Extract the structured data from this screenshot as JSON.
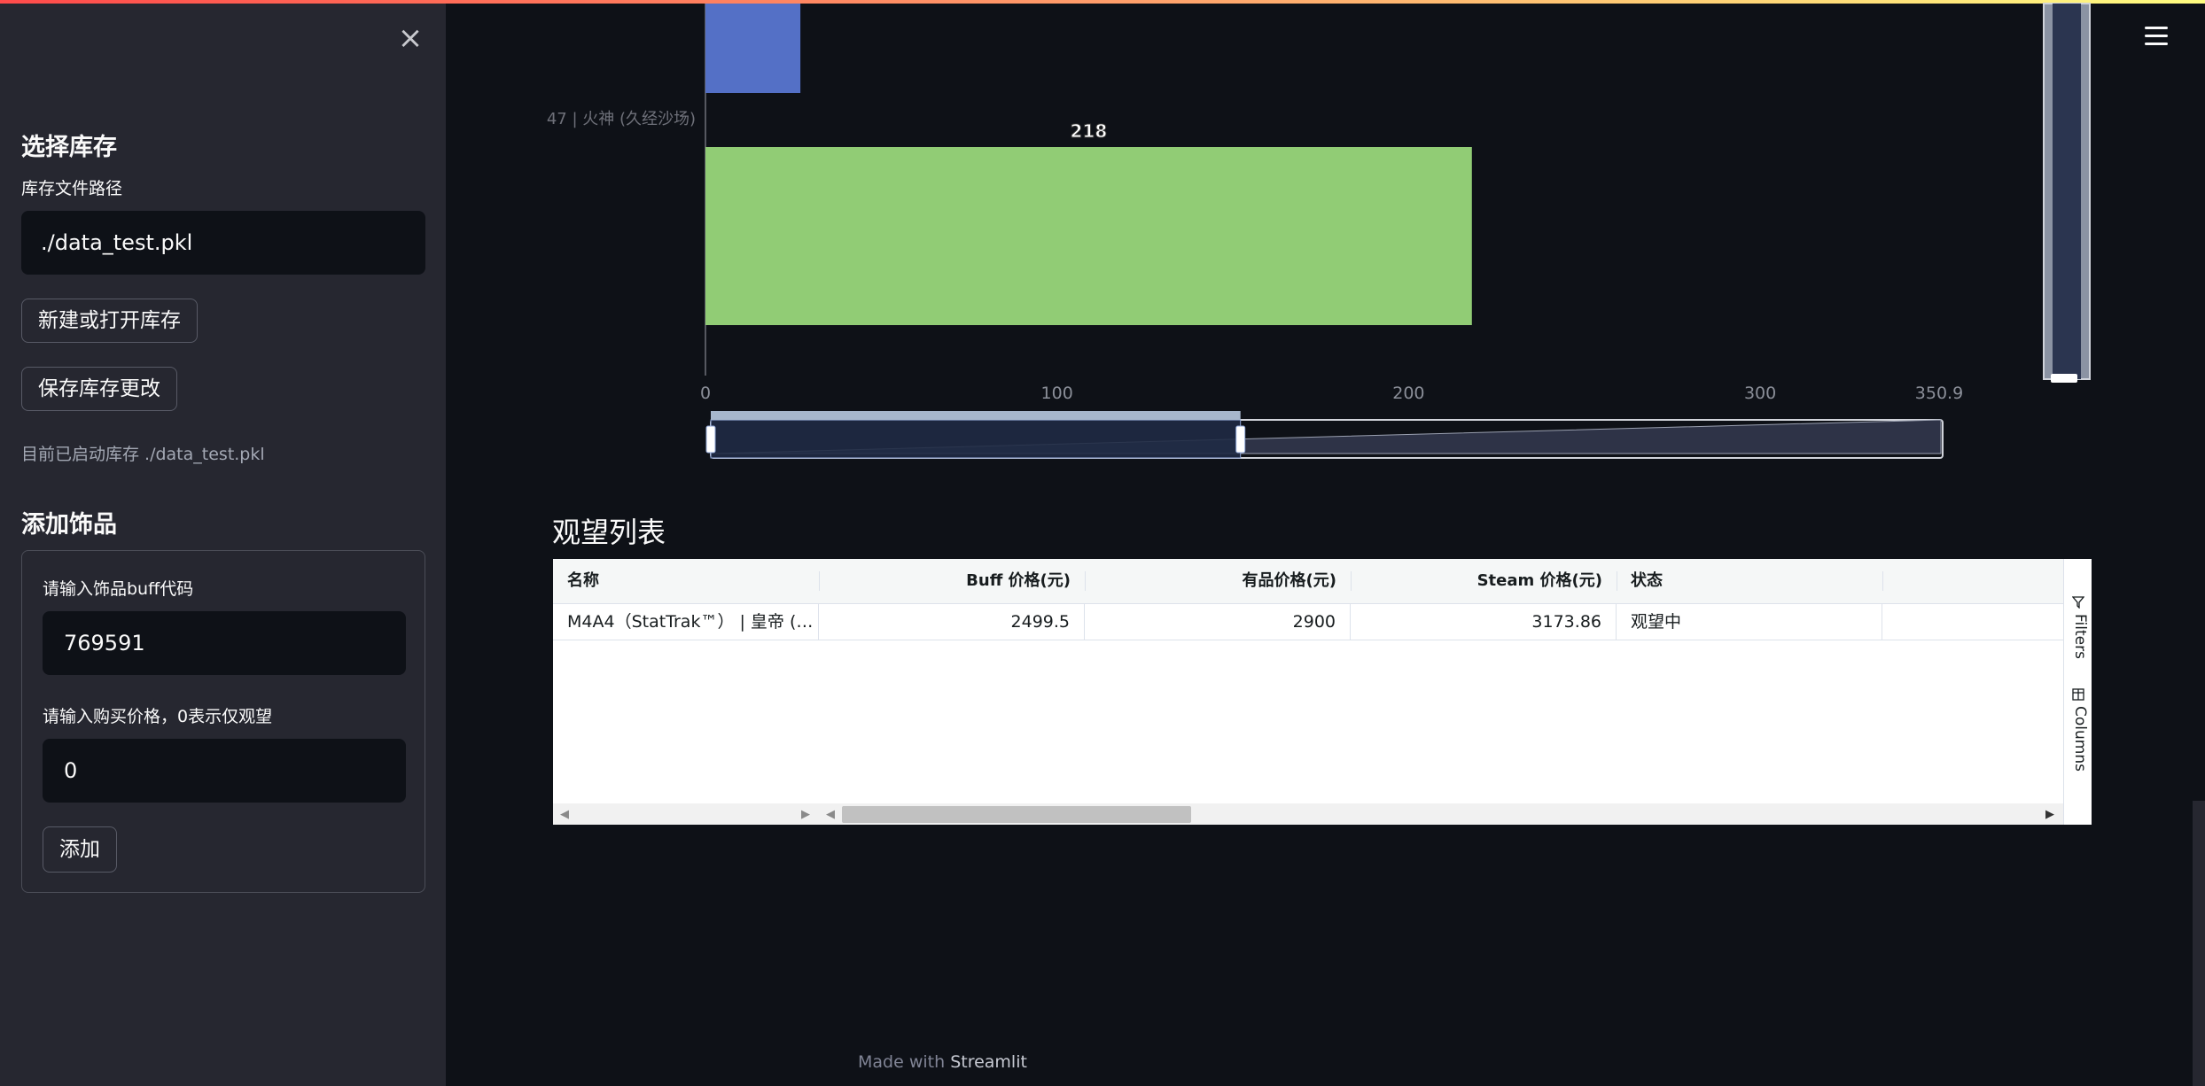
{
  "sidebar": {
    "close_label": "×",
    "inventory_heading": "选择库存",
    "path_label": "库存文件路径",
    "path_value": "./data_test.pkl",
    "open_button": "新建或打开库存",
    "save_button": "保存库存更改",
    "status_caption": "目前已启动库存 ./data_test.pkl",
    "add_heading": "添加饰品",
    "code_label": "请输入饰品buff代码",
    "code_value": "769591",
    "price_label": "请输入购买价格，0表示仅观望",
    "price_value": "0",
    "add_button": "添加"
  },
  "header": {
    "menu_icon": "hamburger-menu-icon"
  },
  "chart_data": {
    "type": "bar",
    "orientation": "horizontal",
    "categories": [
      "47 | 火神 (久经沙场)"
    ],
    "partial_bar_above": {
      "value": 27,
      "color": "#5470c6"
    },
    "values": [
      218
    ],
    "data_labels": [
      "218"
    ],
    "bar_color": "#91cc75",
    "xlim": [
      0,
      350.9
    ],
    "x_ticks": [
      "0",
      "100",
      "200",
      "300",
      "350.9"
    ],
    "datazoom": {
      "start_percent": 0,
      "end_percent": 43
    }
  },
  "watchlist": {
    "title": "观望列表",
    "columns": [
      "名称",
      "Buff 价格(元)",
      "有品价格(元)",
      "Steam 价格(元)",
      "状态"
    ],
    "rows": [
      [
        "M4A4（StatTrak™） | 皇帝 (…",
        "2499.5",
        "2900",
        "3173.86",
        "观望中"
      ]
    ],
    "side_tabs": [
      "Filters",
      "Columns"
    ]
  },
  "footer": {
    "prefix": "Made with",
    "brand": "Streamlit"
  }
}
